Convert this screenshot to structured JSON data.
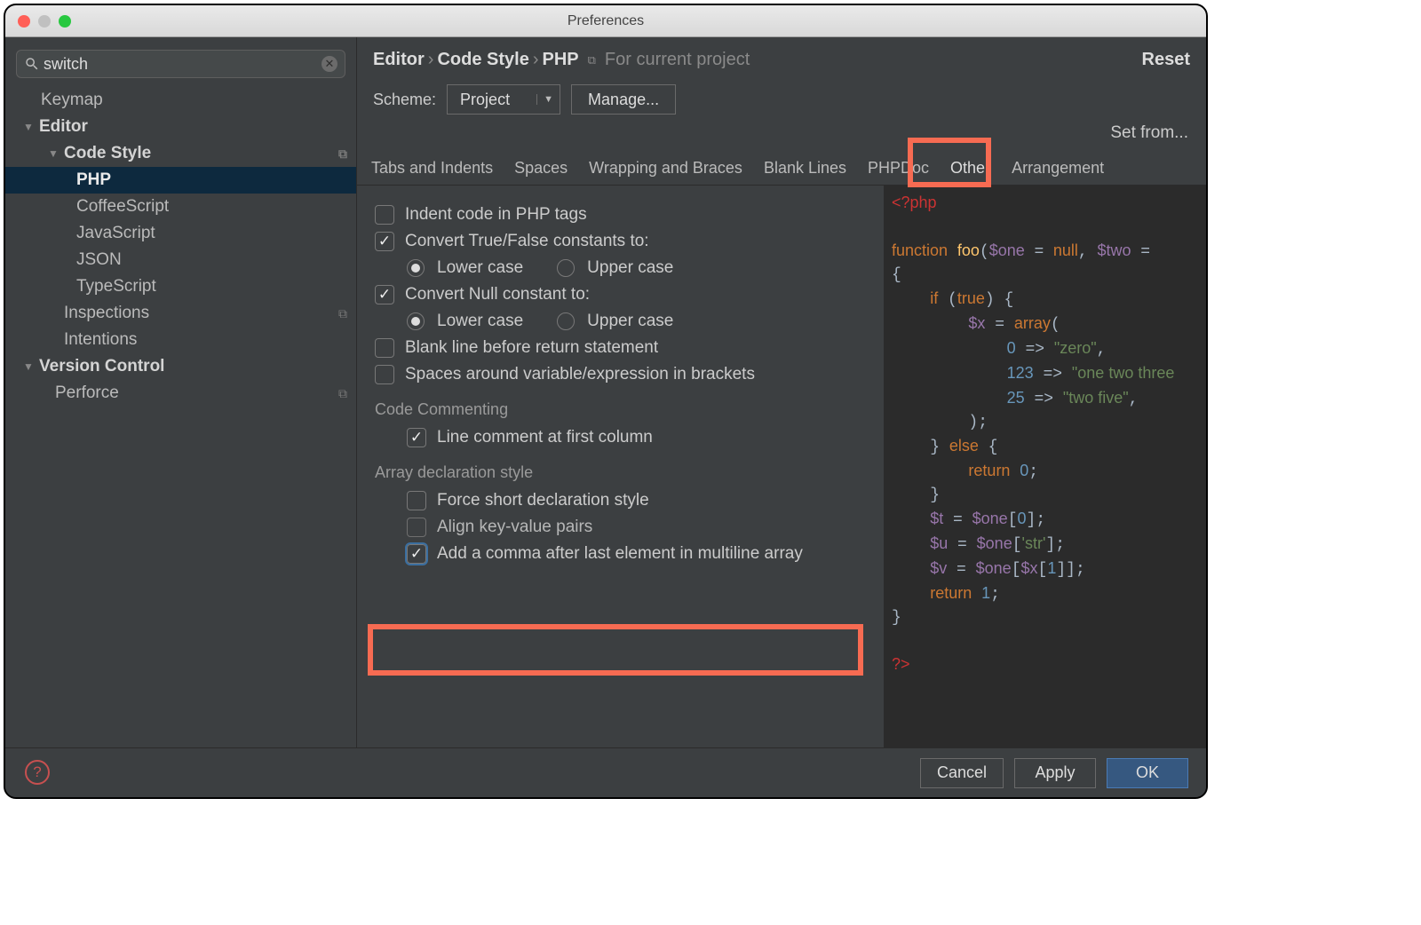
{
  "window": {
    "title": "Preferences"
  },
  "search": {
    "value": "switch"
  },
  "tree": {
    "keymap": "Keymap",
    "editor": "Editor",
    "codestyle": "Code Style",
    "php": "PHP",
    "coffee": "CoffeeScript",
    "js": "JavaScript",
    "json": "JSON",
    "ts": "TypeScript",
    "inspections": "Inspections",
    "intentions": "Intentions",
    "vc": "Version Control",
    "perforce": "Perforce"
  },
  "breadcrumb": {
    "a": "Editor",
    "b": "Code Style",
    "c": "PHP",
    "scope": "For current project",
    "reset": "Reset"
  },
  "scheme": {
    "label": "Scheme:",
    "value": "Project",
    "manage": "Manage...",
    "setfrom": "Set from..."
  },
  "tabs": {
    "t0": "Tabs and Indents",
    "t1": "Spaces",
    "t2": "Wrapping and Braces",
    "t3": "Blank Lines",
    "t4": "PHPDoc",
    "t5": "Other",
    "t6": "Arrangement"
  },
  "opts": {
    "indent": "Indent code in PHP tags",
    "convTF": "Convert True/False constants to:",
    "lower": "Lower case",
    "upper": "Upper case",
    "convNull": "Convert Null constant to:",
    "blankret": "Blank line before return statement",
    "spacesexpr": "Spaces around variable/expression in brackets",
    "commentHead": "Code Commenting",
    "lineComment": "Line comment at first column",
    "arrayHead": "Array declaration style",
    "forceShort": "Force short declaration style",
    "alignKV": "Align key-value pairs",
    "addComma": "Add a comma after last element in multiline array"
  },
  "footer": {
    "cancel": "Cancel",
    "apply": "Apply",
    "ok": "OK"
  },
  "code": {
    "l0": "<?php",
    "l1": "function foo($one = null, $two = ",
    "l2": "{",
    "l3": "    if (true) {",
    "l4": "        $x = array(",
    "l5": "            0 => \"zero\",",
    "l6": "            123 => \"one two three",
    "l7": "            25 => \"two five\",",
    "l8": "        );",
    "l9": "    } else {",
    "l10": "        return 0;",
    "l11": "    }",
    "l12": "    $t = $one[0];",
    "l13": "    $u = $one['str'];",
    "l14": "    $v = $one[$x[1]];",
    "l15": "    return 1;",
    "l16": "}",
    "l17": "",
    "l18": "?>"
  }
}
